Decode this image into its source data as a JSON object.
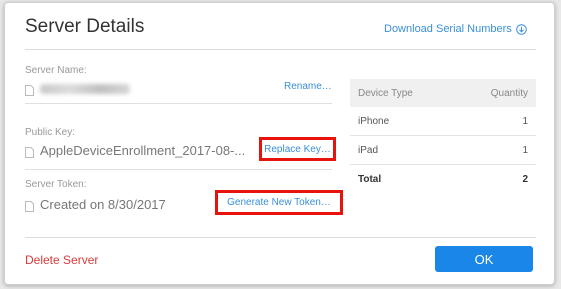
{
  "dialog": {
    "title": "Server Details",
    "download_label": "Download Serial Numbers"
  },
  "server_name": {
    "label": "Server Name:",
    "rename_label": "Rename…"
  },
  "public_key": {
    "label": "Public Key:",
    "value": "AppleDeviceEnrollment_2017-08-...",
    "replace_label": "Replace Key…"
  },
  "server_token": {
    "label": "Server Token:",
    "value": "Created on 8/30/2017",
    "generate_label": "Generate New Token…"
  },
  "device_table": {
    "headers": [
      "Device Type",
      "Quantity"
    ],
    "rows": [
      {
        "type": "iPhone",
        "quantity": "1"
      },
      {
        "type": "iPad",
        "quantity": "1"
      }
    ],
    "total_label": "Total",
    "total_value": "2"
  },
  "footer": {
    "delete_label": "Delete Server",
    "ok_label": "OK"
  },
  "colors": {
    "accent": "#1a86e8",
    "link": "#3a8fd8",
    "destructive": "#d63a3a",
    "highlight": "#e8120c"
  },
  "icons": {
    "download": "download-circle-icon",
    "document": "document-icon"
  }
}
